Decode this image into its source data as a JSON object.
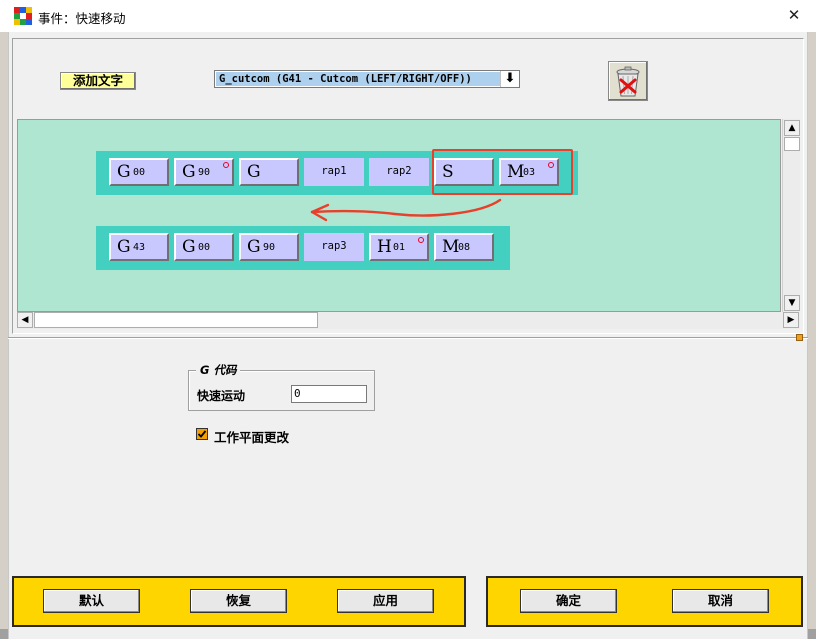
{
  "window": {
    "title": "事件：快速移动",
    "close_glyph": "✕"
  },
  "toolbar": {
    "add_text_label": "添加文字",
    "command_select_value": "G_cutcom (G41 - Cutcom (LEFT/RIGHT/OFF))",
    "dropdown_glyph": "⬇"
  },
  "canvas": {
    "row1": [
      {
        "letter": "G",
        "sub": "00",
        "flag": false
      },
      {
        "letter": "G",
        "sub": "90",
        "flag": true
      },
      {
        "letter": "G",
        "sub": "",
        "flag": false
      },
      {
        "label": "rap1"
      },
      {
        "label": "rap2"
      },
      {
        "letter": "S",
        "sub": "",
        "flag": false
      },
      {
        "letter": "M",
        "sub": "03",
        "flag": true
      }
    ],
    "row2": [
      {
        "letter": "G",
        "sub": "43",
        "flag": false
      },
      {
        "letter": "G",
        "sub": "00",
        "flag": false
      },
      {
        "letter": "G",
        "sub": "90",
        "flag": false
      },
      {
        "label": "rap3"
      },
      {
        "letter": "H",
        "sub": "01",
        "flag": true
      },
      {
        "letter": "M",
        "sub": "08",
        "flag": false
      }
    ],
    "annotation_color": "#e8402a"
  },
  "gcode": {
    "group_title": "G 代码",
    "rapid_label": "快速运动",
    "rapid_value": "0"
  },
  "options": {
    "work_plane_change_label": "工作平面更改",
    "work_plane_change_checked": true
  },
  "buttons": {
    "default_label": "默认",
    "restore_label": "恢复",
    "apply_label": "应用",
    "ok_label": "确定",
    "cancel_label": "取消"
  },
  "colors": {
    "canvas_bg": "#afe6d2",
    "row_strip": "#44d0c0",
    "tile": "#c8c8ff",
    "button_bar": "#ffd500",
    "selection": "#aed0ef"
  }
}
